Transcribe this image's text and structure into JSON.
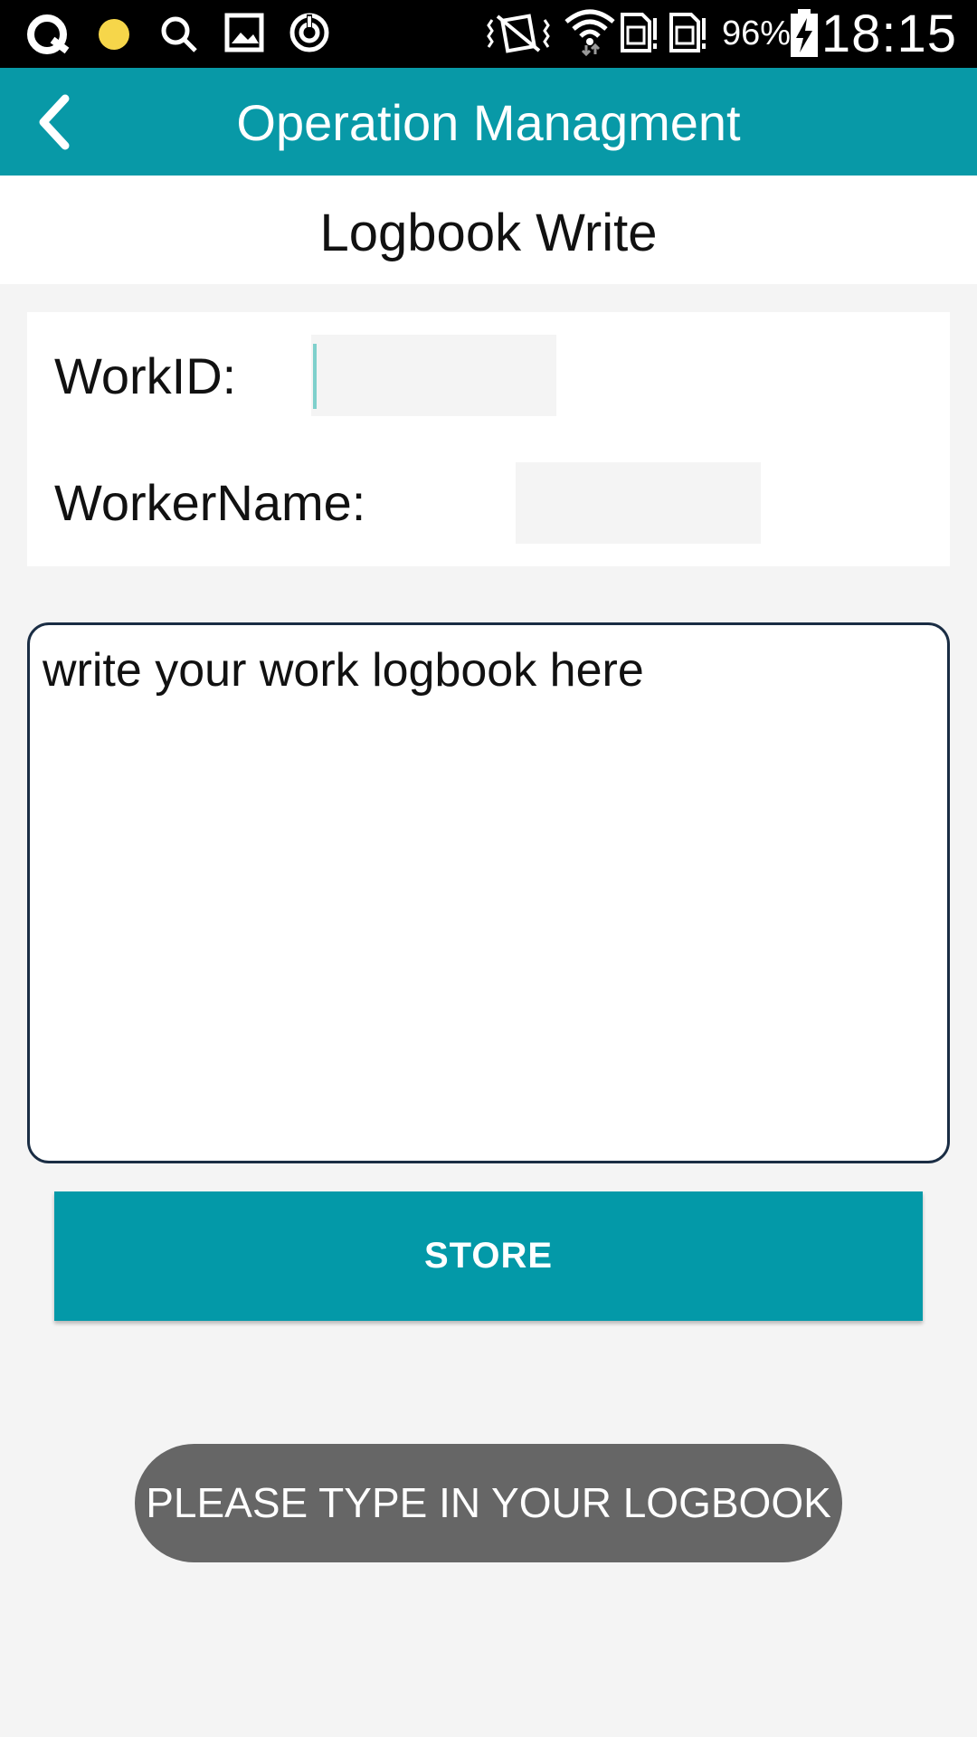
{
  "status_bar": {
    "icons": [
      "quip-icon",
      "yellow-dot-icon",
      "search-icon",
      "image-icon",
      "sync-icon",
      "vibrate-icon",
      "wifi-icon",
      "sim1-icon",
      "sim2-icon",
      "battery-charging-icon"
    ],
    "battery": "96%",
    "time": "18:15"
  },
  "app_bar": {
    "title": "Operation Managment",
    "back_icon": "chevron-left-icon",
    "color": "#0899a7"
  },
  "subheader": {
    "title": "Logbook Write"
  },
  "form": {
    "work_id_label": "WorkID:",
    "work_id_value": "",
    "worker_name_label": "WorkerName:",
    "worker_name_value": ""
  },
  "logbook": {
    "placeholder": "write your work logbook here"
  },
  "store_button": {
    "label": "STORE",
    "color": "#0399a8"
  },
  "toast": {
    "message": "PLEASE TYPE IN YOUR LOGBOOK"
  }
}
